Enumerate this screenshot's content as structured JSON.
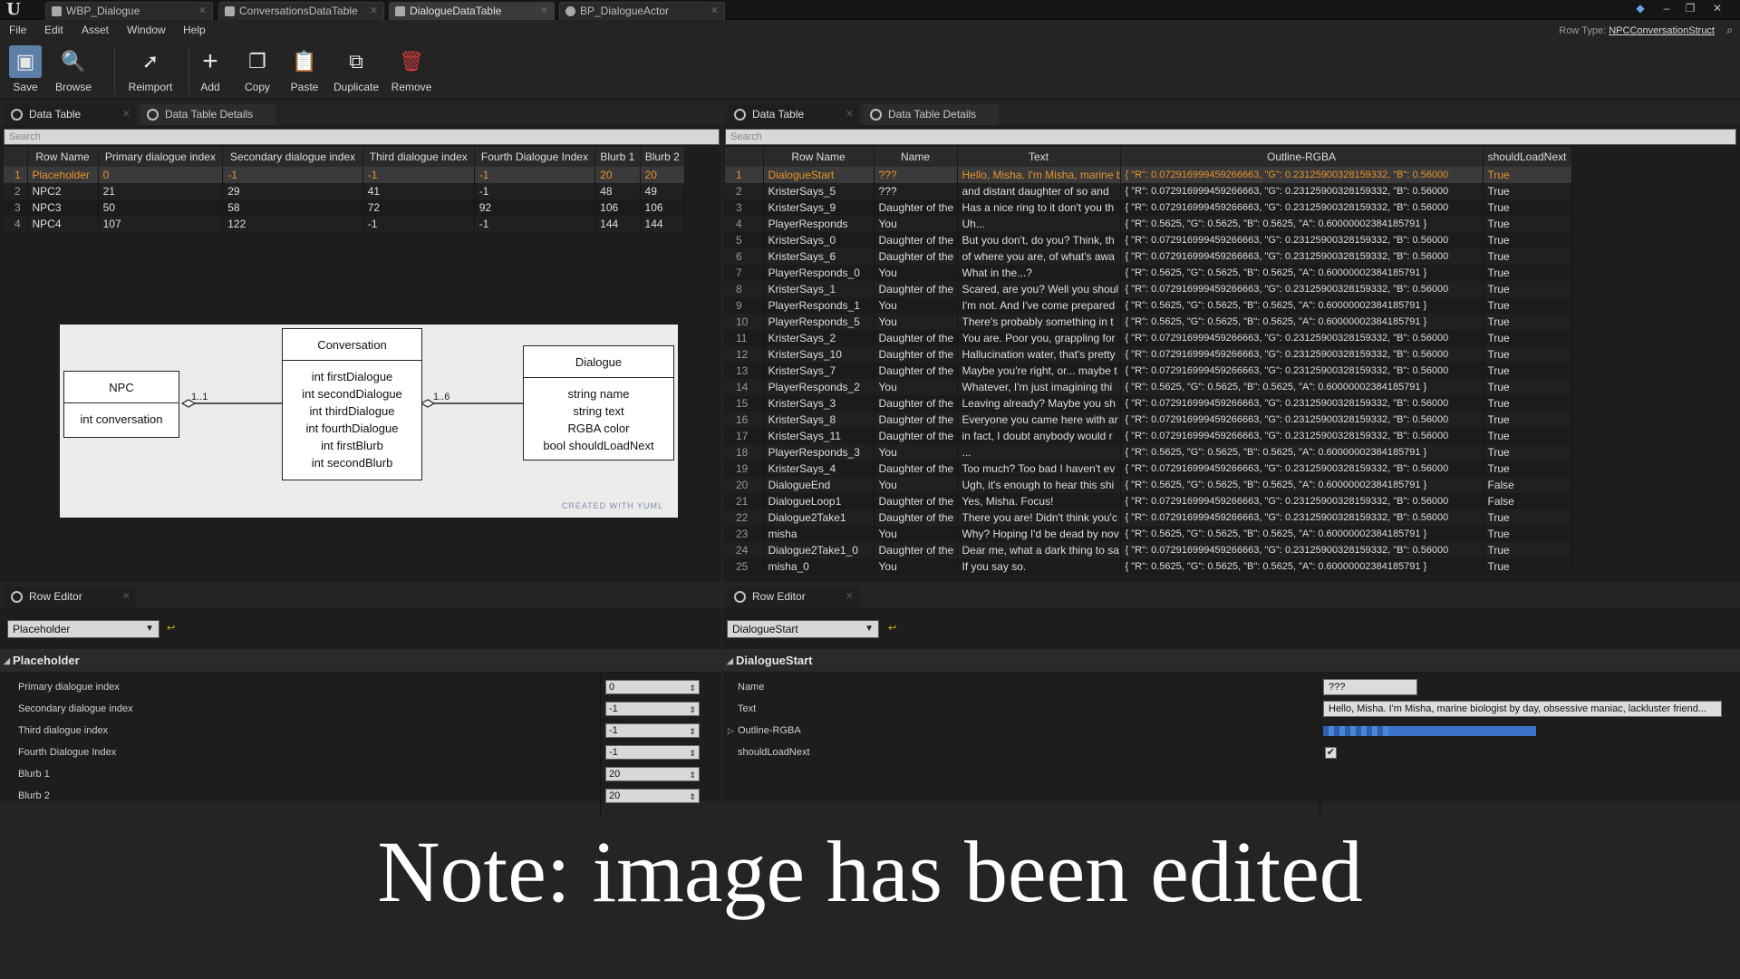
{
  "titlebar": {
    "tabs": [
      "WBP_Dialogue",
      "ConversationsDataTable",
      "DialogueDataTable",
      "BP_DialogueActor"
    ],
    "controls": [
      "–",
      "❐",
      "✕"
    ]
  },
  "menu": {
    "items": [
      "File",
      "Edit",
      "Asset",
      "Window",
      "Help"
    ],
    "row_type_label": "Row Type:",
    "row_type_value": "NPCConversationStruct"
  },
  "toolbar": {
    "save": "Save",
    "browse": "Browse",
    "reimport": "Reimport",
    "add": "Add",
    "copy": "Copy",
    "paste": "Paste",
    "duplicate": "Duplicate",
    "remove": "Remove"
  },
  "left_panel": {
    "tabs": [
      "Data Table",
      "Data Table Details"
    ],
    "search_placeholder": "Search",
    "columns": [
      "Row Name",
      "Primary dialogue index",
      "Secondary dialogue index",
      "Third dialogue index",
      "Fourth Dialogue Index",
      "Blurb 1",
      "Blurb 2"
    ],
    "rows": [
      [
        "1",
        "Placeholder",
        "0",
        "-1",
        "-1",
        "-1",
        "20",
        "20"
      ],
      [
        "2",
        "NPC2",
        "21",
        "29",
        "41",
        "-1",
        "48",
        "49"
      ],
      [
        "3",
        "NPC3",
        "50",
        "58",
        "72",
        "92",
        "106",
        "106"
      ],
      [
        "4",
        "NPC4",
        "107",
        "122",
        "-1",
        "-1",
        "144",
        "144"
      ]
    ]
  },
  "diagram": {
    "npc": {
      "title": "NPC",
      "fields": [
        "int conversation"
      ]
    },
    "conversation": {
      "title": "Conversation",
      "fields": [
        "int firstDialogue",
        "int secondDialogue",
        "int thirdDialogue",
        "int fourthDialogue",
        "int firstBlurb",
        "int secondBlurb"
      ]
    },
    "dialogue": {
      "title": "Dialogue",
      "fields": [
        "string name",
        "string text",
        "RGBA color",
        "bool shouldLoadNext"
      ]
    },
    "mult1": "1..1",
    "mult2": "1..6",
    "credit": "CREATED WITH YUML"
  },
  "right_panel": {
    "tabs": [
      "Data Table",
      "Data Table Details"
    ],
    "search_placeholder": "Search",
    "columns": [
      "Row Name",
      "Name",
      "Text",
      "Outline-RGBA",
      "shouldLoadNext"
    ],
    "rows": [
      [
        "1",
        "DialogueStart",
        "???",
        "Hello, Misha. I'm Misha, marine b",
        "{ \"R\": 0.0729169994592666­63, \"G\": 0.231259003281593­32, \"B\": 0.56000",
        "True"
      ],
      [
        "2",
        "KristerSays_5",
        "???",
        "and distant daughter of so and",
        "{ \"R\": 0.072916999459266663, \"G\": 0.23125900328159332, \"B\": 0.56000",
        "True"
      ],
      [
        "3",
        "KristerSays_9",
        "Daughter of the",
        "Has a nice ring to it don't you th",
        "{ \"R\": 0.072916999459266663, \"G\": 0.23125900328159332, \"B\": 0.56000",
        "True"
      ],
      [
        "4",
        "PlayerResponds",
        "You",
        "Uh...",
        "{ \"R\": 0.5625, \"G\": 0.5625, \"B\": 0.5625, \"A\": 0.60000002384185791 }",
        "True"
      ],
      [
        "5",
        "KristerSays_0",
        "Daughter of the",
        "But you don't, do you? Think, th",
        "{ \"R\": 0.072916999459266663, \"G\": 0.23125900328159332, \"B\": 0.56000",
        "True"
      ],
      [
        "6",
        "KristerSays_6",
        "Daughter of the",
        "of where you are, of what's awa",
        "{ \"R\": 0.072916999459266663, \"G\": 0.23125900328159332, \"B\": 0.56000",
        "True"
      ],
      [
        "7",
        "PlayerResponds_0",
        "You",
        "What in the...?",
        "{ \"R\": 0.5625, \"G\": 0.5625, \"B\": 0.5625, \"A\": 0.60000002384185791 }",
        "True"
      ],
      [
        "8",
        "KristerSays_1",
        "Daughter of the",
        "Scared, are you? Well you shoul",
        "{ \"R\": 0.072916999459266663, \"G\": 0.23125900328159332, \"B\": 0.56000",
        "True"
      ],
      [
        "9",
        "PlayerResponds_1",
        "You",
        "I'm not. And I've come prepared",
        "{ \"R\": 0.5625, \"G\": 0.5625, \"B\": 0.5625, \"A\": 0.60000002384185791 }",
        "True"
      ],
      [
        "10",
        "PlayerResponds_5",
        "You",
        "There's probably something in t",
        "{ \"R\": 0.5625, \"G\": 0.5625, \"B\": 0.5625, \"A\": 0.60000002384185791 }",
        "True"
      ],
      [
        "11",
        "KristerSays_2",
        "Daughter of the",
        "You are. Poor you, grappling for",
        "{ \"R\": 0.072916999459266663, \"G\": 0.23125900328159332, \"B\": 0.56000",
        "True"
      ],
      [
        "12",
        "KristerSays_10",
        "Daughter of the",
        "Hallucination water, that's pretty",
        "{ \"R\": 0.072916999459266663, \"G\": 0.23125900328159332, \"B\": 0.56000",
        "True"
      ],
      [
        "13",
        "KristerSays_7",
        "Daughter of the",
        "Maybe you're right, or... maybe t",
        "{ \"R\": 0.072916999459266663, \"G\": 0.23125900328159332, \"B\": 0.56000",
        "True"
      ],
      [
        "14",
        "PlayerResponds_2",
        "You",
        "Whatever, I'm just imagining thi",
        "{ \"R\": 0.5625, \"G\": 0.5625, \"B\": 0.5625, \"A\": 0.60000002384185791 }",
        "True"
      ],
      [
        "15",
        "KristerSays_3",
        "Daughter of the",
        "Leaving already? Maybe you sh",
        "{ \"R\": 0.072916999459266663, \"G\": 0.23125900328159332, \"B\": 0.56000",
        "True"
      ],
      [
        "16",
        "KristerSays_8",
        "Daughter of the",
        "Everyone you came here with ar",
        "{ \"R\": 0.072916999459266663, \"G\": 0.23125900328159332, \"B\": 0.56000",
        "True"
      ],
      [
        "17",
        "KristerSays_11",
        "Daughter of the",
        "in fact, I doubt anybody would r",
        "{ \"R\": 0.072916999459266663, \"G\": 0.23125900328159332, \"B\": 0.56000",
        "True"
      ],
      [
        "18",
        "PlayerResponds_3",
        "You",
        "...",
        "{ \"R\": 0.5625, \"G\": 0.5625, \"B\": 0.5625, \"A\": 0.60000002384185791 }",
        "True"
      ],
      [
        "19",
        "KristerSays_4",
        "Daughter of the",
        "Too much? Too bad I haven't ev",
        "{ \"R\": 0.072916999459266663, \"G\": 0.23125900328159332, \"B\": 0.56000",
        "True"
      ],
      [
        "20",
        "DialogueEnd",
        "You",
        "Ugh, it's enough to hear this shi",
        "{ \"R\": 0.5625, \"G\": 0.5625, \"B\": 0.5625, \"A\": 0.60000002384185791 }",
        "False"
      ],
      [
        "21",
        "DialogueLoop1",
        "Daughter of the",
        "Yes, Misha. Focus!",
        "{ \"R\": 0.072916999459266663, \"G\": 0.23125900328159332, \"B\": 0.56000",
        "False"
      ],
      [
        "22",
        "Dialogue2Take1",
        "Daughter of the",
        "There you are! Didn't think you'c",
        "{ \"R\": 0.072916999459266663, \"G\": 0.23125900328159332, \"B\": 0.56000",
        "True"
      ],
      [
        "23",
        "misha",
        "You",
        "Why? Hoping I'd be dead by nov",
        "{ \"R\": 0.5625, \"G\": 0.5625, \"B\": 0.5625, \"A\": 0.60000002384185791 }",
        "True"
      ],
      [
        "24",
        "Dialogue2Take1_0",
        "Daughter of the",
        "Dear me, what a dark thing to sa",
        "{ \"R\": 0.072916999459266663, \"G\": 0.23125900328159332, \"B\": 0.56000",
        "True"
      ],
      [
        "25",
        "misha_0",
        "You",
        "If you say so.",
        "{ \"R\": 0.5625, \"G\": 0.5625, \"B\": 0.5625, \"A\": 0.60000002384185791 }",
        "True"
      ]
    ]
  },
  "left_row_editor": {
    "tab": "Row Editor",
    "selected_row": "Placeholder",
    "category": "Placeholder",
    "props": [
      {
        "name": "Primary dialogue index",
        "value": "0"
      },
      {
        "name": "Secondary dialogue index",
        "value": "-1"
      },
      {
        "name": "Third dialogue index",
        "value": "-1"
      },
      {
        "name": "Fourth Dialogue Index",
        "value": "-1"
      },
      {
        "name": "Blurb 1",
        "value": "20"
      },
      {
        "name": "Blurb 2",
        "value": "20"
      }
    ]
  },
  "right_row_editor": {
    "tab": "Row Editor",
    "selected_row": "DialogueStart",
    "category": "DialogueStart",
    "props": [
      {
        "name": "Name",
        "value": "???"
      },
      {
        "name": "Text",
        "value": "Hello, Misha. I'm Misha, marine biologist by day, obsessive maniac, lackluster friend..."
      },
      {
        "name": "Outline-RGBA",
        "value": ""
      },
      {
        "name": "shouldLoadNext",
        "value": "✔"
      }
    ]
  },
  "note": "Note: image has been edited",
  "colors": {
    "accent_selected": "#e8932c",
    "color_bar": "#3a73c7"
  }
}
